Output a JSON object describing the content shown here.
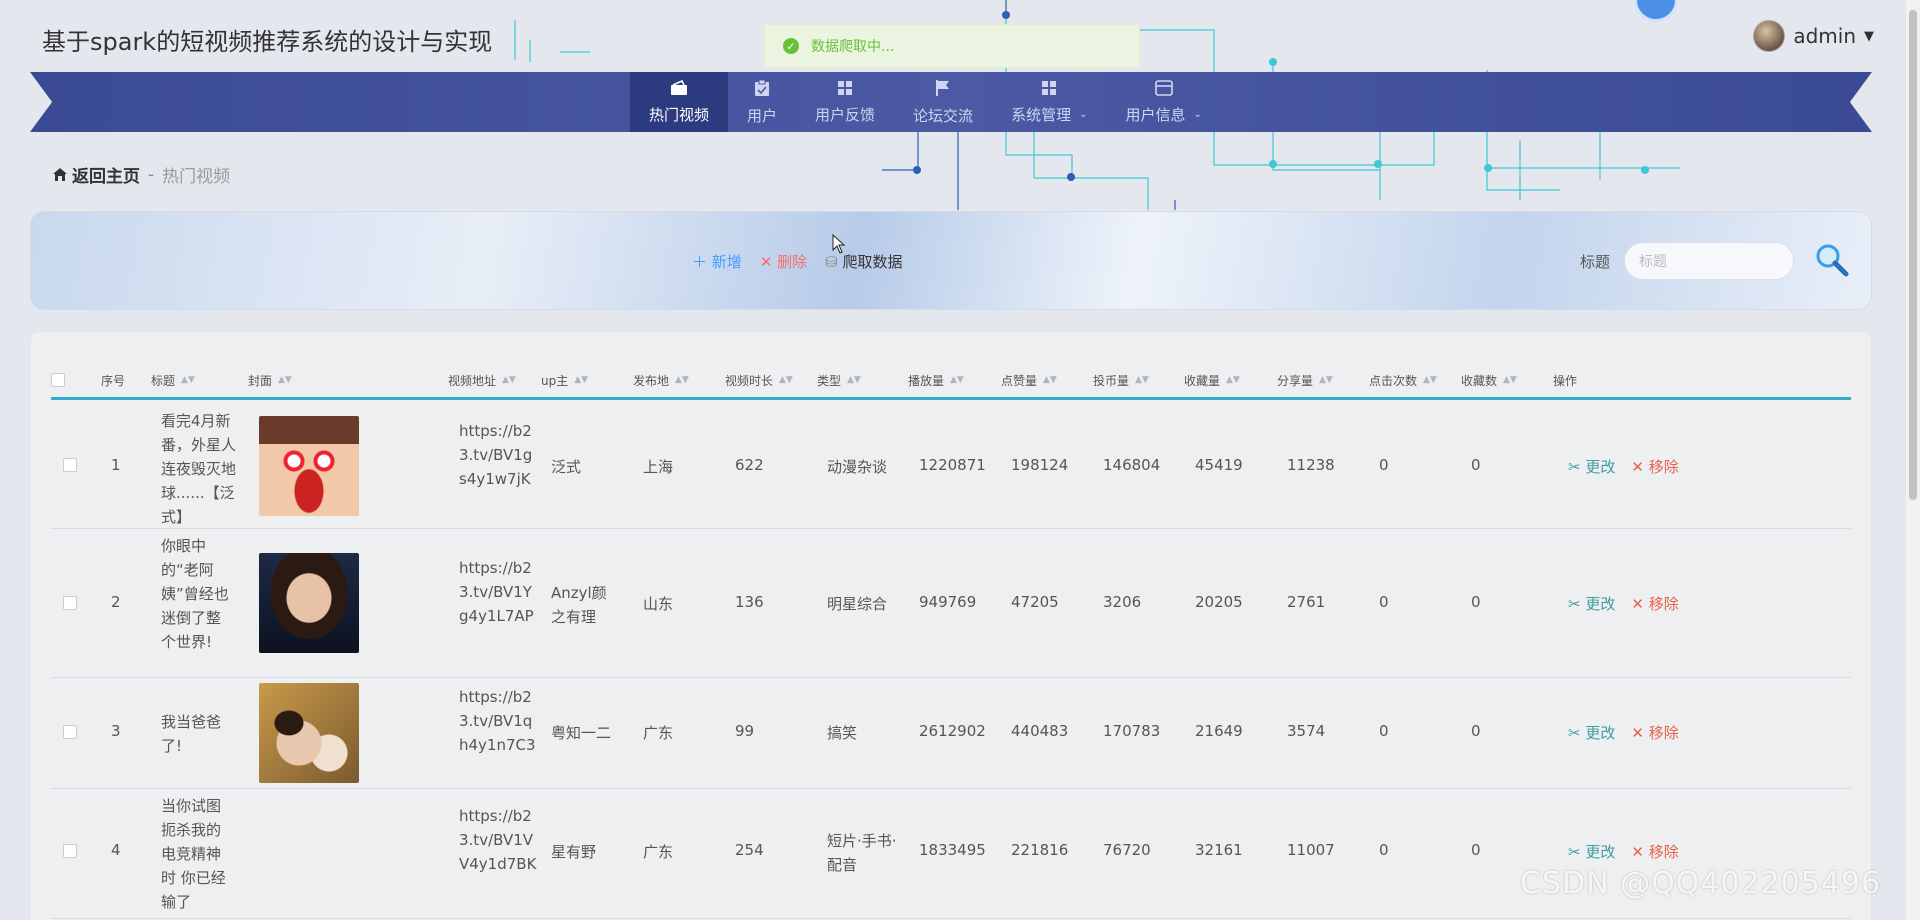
{
  "header": {
    "title": "基于spark的短视频推荐系统的设计与实现",
    "username": "admin"
  },
  "toast": {
    "message": "数据爬取中..."
  },
  "nav": [
    {
      "label": "热门视频",
      "icon": "wallet-icon",
      "active": true
    },
    {
      "label": "用户",
      "icon": "clipboard-icon"
    },
    {
      "label": "用户反馈",
      "icon": "grid-icon"
    },
    {
      "label": "论坛交流",
      "icon": "flag-icon"
    },
    {
      "label": "系统管理",
      "icon": "grid-icon",
      "dropdown": true
    },
    {
      "label": "用户信息",
      "icon": "card-icon",
      "dropdown": true
    }
  ],
  "breadcrumb": {
    "home": "返回主页",
    "sep": "-",
    "current": "热门视频"
  },
  "toolbar": {
    "add": "新增",
    "delete": "删除",
    "crawl": "爬取数据",
    "search_label": "标题",
    "search_placeholder": "标题"
  },
  "table": {
    "headers": [
      "序号",
      "标题",
      "封面",
      "视频地址",
      "up主",
      "发布地",
      "视频时长",
      "类型",
      "播放量",
      "点赞量",
      "投币量",
      "收藏量",
      "分享量",
      "点击次数",
      "收藏数",
      "操作"
    ],
    "rows": [
      {
        "index": "1",
        "title": "看完4月新番，外星人连夜毁灭地球......【泛式】",
        "url": "https://b23.tv/BV1gs4y1w7jK",
        "up": "泛式",
        "place": "上海",
        "duration": "622",
        "type": "动漫杂谈",
        "plays": "1220871",
        "likes": "198124",
        "coins": "146804",
        "favs": "45419",
        "shares": "11238",
        "clicks": "0",
        "collects": "0"
      },
      {
        "index": "2",
        "title": "你眼中的“老阿姨”曾经也迷倒了整个世界!",
        "url": "https://b23.tv/BV1Yg4y1L7AP",
        "up": "Anzyl颜之有理",
        "place": "山东",
        "duration": "136",
        "type": "明星综合",
        "plays": "949769",
        "likes": "47205",
        "coins": "3206",
        "favs": "20205",
        "shares": "2761",
        "clicks": "0",
        "collects": "0"
      },
      {
        "index": "3",
        "title": "我当爸爸了!",
        "url": "https://b23.tv/BV1qh4y1n7C3",
        "up": "粤知一二",
        "place": "广东",
        "duration": "99",
        "type": "搞笑",
        "plays": "2612902",
        "likes": "440483",
        "coins": "170783",
        "favs": "21649",
        "shares": "3574",
        "clicks": "0",
        "collects": "0"
      },
      {
        "index": "4",
        "title": "当你试图扼杀我的电竞精神时 你已经输了",
        "url": "https://b23.tv/BV1VV4y1d7BK",
        "up": "星有野",
        "place": "广东",
        "duration": "254",
        "type": "短片·手书·配音",
        "plays": "1833495",
        "likes": "221816",
        "coins": "76720",
        "favs": "32161",
        "shares": "11007",
        "clicks": "0",
        "collects": "0"
      }
    ],
    "edit_label": "更改",
    "remove_label": "移除"
  },
  "watermark": "CSDN @QQ402205496",
  "colors": {
    "nav": "#3b4a94",
    "accent": "#35a9c8",
    "edit": "#409e9e",
    "remove": "#e8604c"
  }
}
